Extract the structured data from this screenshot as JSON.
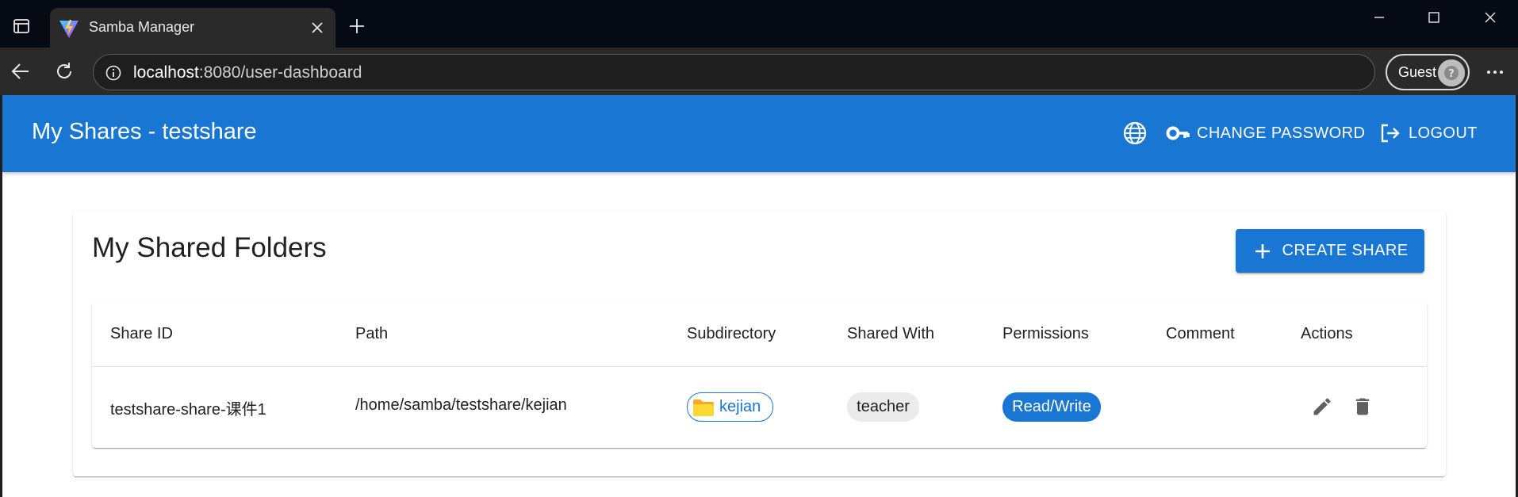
{
  "browser": {
    "tab_title": "Samba Manager",
    "url_host": "localhost",
    "url_rest": ":8080/user-dashboard",
    "profile_label": "Guest"
  },
  "app_bar": {
    "title": "My Shares - testshare",
    "change_password_label": "CHANGE PASSWORD",
    "logout_label": "LOGOUT"
  },
  "card": {
    "title": "My Shared Folders",
    "create_label": "CREATE SHARE"
  },
  "table": {
    "headers": [
      "Share ID",
      "Path",
      "Subdirectory",
      "Shared With",
      "Permissions",
      "Comment",
      "Actions"
    ],
    "rows": [
      {
        "share_id": "testshare-share-课件1",
        "path": "/home/samba/testshare/kejian",
        "subdirectory": "kejian",
        "shared_with": "teacher",
        "permissions": "Read/Write",
        "comment": ""
      }
    ]
  },
  "icons": {
    "tab_favicon": "vite-logo-icon",
    "language": "globe-icon",
    "change_password": "key-icon",
    "logout": "logout-icon",
    "create": "plus-icon",
    "subdirectory": "folder-icon",
    "edit": "pencil-icon",
    "delete": "trash-icon"
  },
  "colors": {
    "primary": "#1976d2",
    "chip_neutral": "#ebebeb",
    "folder": "#fbc02d",
    "action_icon": "#616161"
  }
}
